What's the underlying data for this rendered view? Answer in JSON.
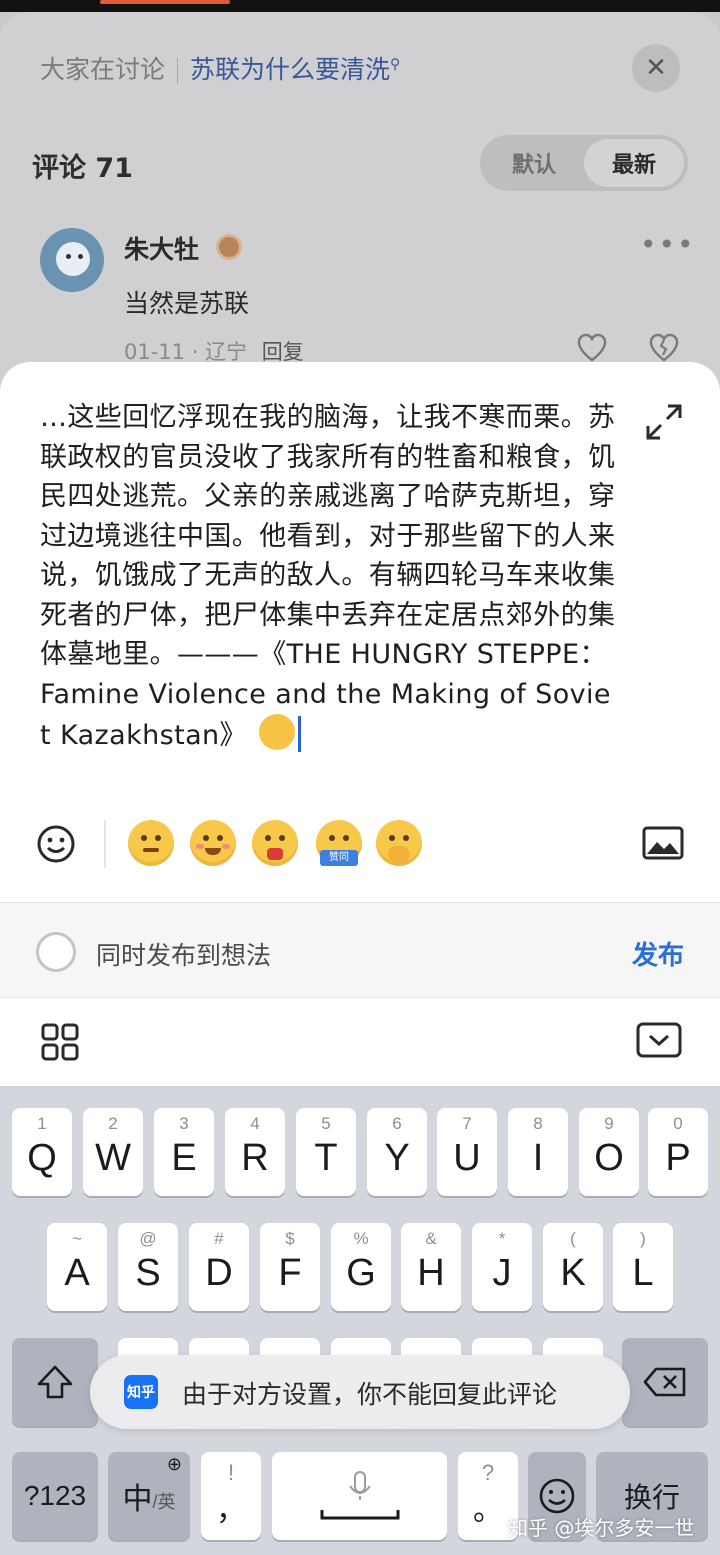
{
  "header": {
    "discuss_label": "大家在讨论",
    "topic": "苏联为什么要清洗"
  },
  "comments": {
    "count_label": "评论 71",
    "sort_default": "默认",
    "sort_latest": "最新"
  },
  "comment": {
    "author": "朱大牡",
    "text": "当然是苏联",
    "date": "01-11",
    "location": "辽宁",
    "reply_label": "回复"
  },
  "composer": {
    "text": "…这些回忆浮现在我的脑海，让我不寒而栗。苏联政权的官员没收了我家所有的牲畜和粮食，饥民四处逃荒。父亲的亲戚逃离了哈萨克斯坦，穿过边境逃往中国。他看到，对于那些留下的人来说，饥饿成了无声的敌人。有辆四轮马车来收集死者的尸体，把尸体集中丢弃在定居点郊外的集体墓地里。———《THE HUNGRY STEPPE：Famine Violence and the Making of Soviet Kazakhstan》",
    "emoji_label": "赞同"
  },
  "publish": {
    "sync_label": "同时发布到想法",
    "publish_label": "发布"
  },
  "keyboard": {
    "row1": [
      {
        "hint": "1",
        "key": "Q"
      },
      {
        "hint": "2",
        "key": "W"
      },
      {
        "hint": "3",
        "key": "E"
      },
      {
        "hint": "4",
        "key": "R"
      },
      {
        "hint": "5",
        "key": "T"
      },
      {
        "hint": "6",
        "key": "Y"
      },
      {
        "hint": "7",
        "key": "U"
      },
      {
        "hint": "8",
        "key": "I"
      },
      {
        "hint": "9",
        "key": "O"
      },
      {
        "hint": "0",
        "key": "P"
      }
    ],
    "row2": [
      {
        "hint": "~",
        "key": "A"
      },
      {
        "hint": "@",
        "key": "S"
      },
      {
        "hint": "#",
        "key": "D"
      },
      {
        "hint": "$",
        "key": "F"
      },
      {
        "hint": "%",
        "key": "G"
      },
      {
        "hint": "&",
        "key": "H"
      },
      {
        "hint": "*",
        "key": "J"
      },
      {
        "hint": "(",
        "key": "K"
      },
      {
        "hint": ")",
        "key": "L"
      }
    ],
    "symbols_key": "?123",
    "lang_key": "中",
    "lang_sub": "/英",
    "comma_hint": "!",
    "comma_key": "，",
    "period_hint": "?",
    "period_key": "。",
    "enter_key": "换行"
  },
  "toast": {
    "logo": "知乎",
    "message": "由于对方设置，你不能回复此评论"
  },
  "watermark": "知乎 @埃尔多安一世"
}
